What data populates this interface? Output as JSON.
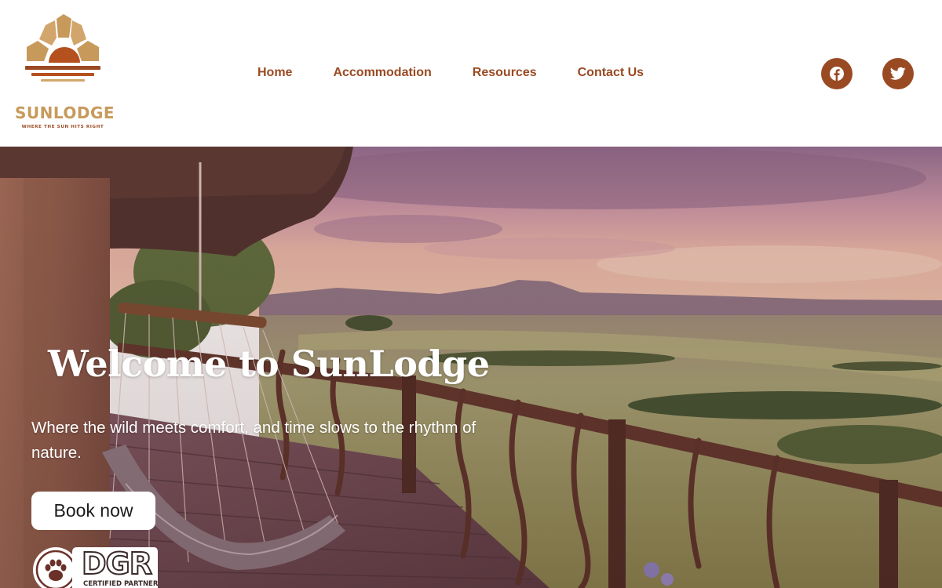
{
  "brand": {
    "name": "SUNLODGE",
    "tagline": "WHERE THE SUN HITS RIGHT"
  },
  "nav": {
    "items": [
      "Home",
      "Accommodation",
      "Resources",
      "Contact Us"
    ]
  },
  "social": {
    "icons": [
      "facebook-icon",
      "twitter-icon"
    ]
  },
  "hero": {
    "title": "Welcome to SunLodge",
    "subtitle": "Where the wild meets comfort, and time slows to the rhythm of nature.",
    "button_label": "Book now"
  },
  "badge": {
    "text": "DGR",
    "subtext": "CERTIFIED PARTNER"
  },
  "colors": {
    "brand_primary": "#9a4a22",
    "brand_gold": "#c79a5b",
    "background": "#ffffff"
  }
}
